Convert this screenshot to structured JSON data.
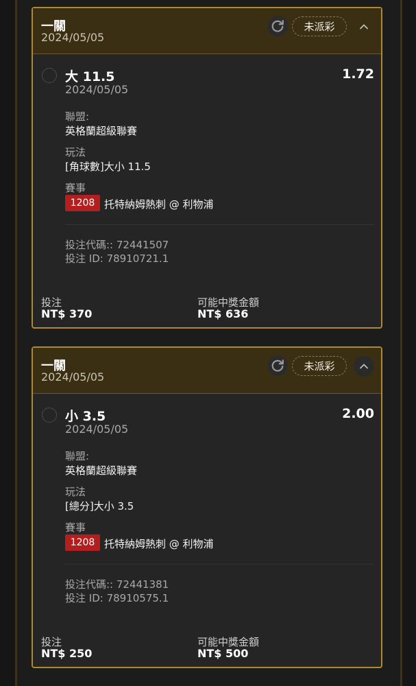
{
  "bets": [
    {
      "header_title": "一關",
      "header_date": "2024/05/05",
      "status": "未派彩",
      "selection": "大 11.5",
      "odds": "1.72",
      "selection_date": "2024/05/05",
      "league_label": "聯盟:",
      "league": "英格蘭超級聯賽",
      "market_label": "玩法",
      "market": "[角球數]大小 11.5",
      "event_label": "賽事",
      "event_no": "1208",
      "event_name": "托特納姆熱刺 @ 利物浦",
      "bet_code": "投注代碼:: 72441507",
      "bet_id": "投注 ID: 78910721.1",
      "stake_label": "投注",
      "stake": "NT$ 370",
      "payout_label": "可能中獎金額",
      "payout": "NT$ 636"
    },
    {
      "header_title": "一關",
      "header_date": "2024/05/05",
      "status": "未派彩",
      "selection": "小 3.5",
      "odds": "2.00",
      "selection_date": "2024/05/05",
      "league_label": "聯盟:",
      "league": "英格蘭超級聯賽",
      "market_label": "玩法",
      "market": "[總分]大小 3.5",
      "event_label": "賽事",
      "event_no": "1208",
      "event_name": "托特納姆熱刺 @ 利物浦",
      "bet_code": "投注代碼:: 72441381",
      "bet_id": "投注 ID: 78910575.1",
      "stake_label": "投注",
      "stake": "NT$ 250",
      "payout_label": "可能中獎金額",
      "payout": "NT$ 500"
    }
  ],
  "icons": {
    "refresh": "refresh-icon",
    "collapse": "chevron-up-icon"
  },
  "colors": {
    "accent_gold": "#b08a2e",
    "header_bg": "#3a2f12",
    "badge_red": "#b31e1e"
  }
}
